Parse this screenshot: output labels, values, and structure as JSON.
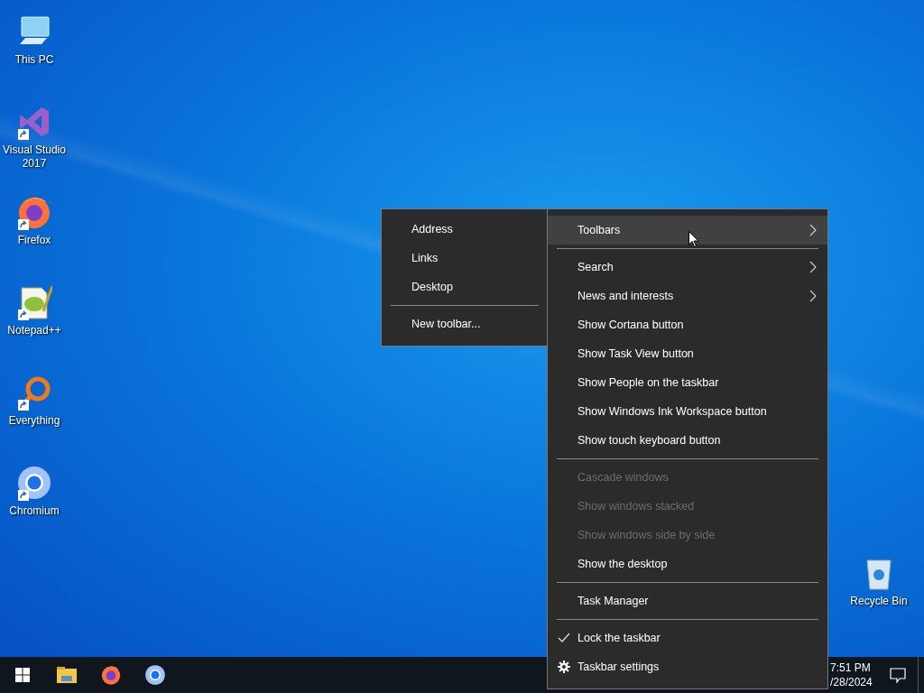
{
  "desktop_icons": [
    {
      "label": "This PC",
      "kind": "pc",
      "shortcut": false
    },
    {
      "label": "Visual Studio 2017",
      "kind": "vs",
      "shortcut": true
    },
    {
      "label": "Firefox",
      "kind": "firefox",
      "shortcut": true
    },
    {
      "label": "Notepad++",
      "kind": "notepad",
      "shortcut": true
    },
    {
      "label": "Everything",
      "kind": "everything",
      "shortcut": true
    },
    {
      "label": "Chromium",
      "kind": "chromium",
      "shortcut": true
    }
  ],
  "recycle_bin": {
    "label": "Recycle Bin"
  },
  "toolbars_submenu": [
    {
      "kind": "item",
      "label": "Address",
      "checked": false
    },
    {
      "kind": "item",
      "label": "Links",
      "checked": false
    },
    {
      "kind": "item",
      "label": "Desktop",
      "checked": false
    },
    {
      "kind": "separator"
    },
    {
      "kind": "item",
      "label": "New toolbar...",
      "checked": false
    }
  ],
  "context_menu": [
    {
      "kind": "item",
      "label": "Toolbars",
      "submenu": true,
      "disabled": false,
      "checked": false,
      "highlighted": true
    },
    {
      "kind": "separator"
    },
    {
      "kind": "item",
      "label": "Search",
      "submenu": true,
      "disabled": false,
      "checked": false,
      "highlighted": false
    },
    {
      "kind": "item",
      "label": "News and interests",
      "submenu": true,
      "disabled": false,
      "checked": false,
      "highlighted": false
    },
    {
      "kind": "item",
      "label": "Show Cortana button",
      "submenu": false,
      "disabled": false,
      "checked": false,
      "highlighted": false
    },
    {
      "kind": "item",
      "label": "Show Task View button",
      "submenu": false,
      "disabled": false,
      "checked": false,
      "highlighted": false
    },
    {
      "kind": "item",
      "label": "Show People on the taskbar",
      "submenu": false,
      "disabled": false,
      "checked": false,
      "highlighted": false
    },
    {
      "kind": "item",
      "label": "Show Windows Ink Workspace button",
      "submenu": false,
      "disabled": false,
      "checked": false,
      "highlighted": false
    },
    {
      "kind": "item",
      "label": "Show touch keyboard button",
      "submenu": false,
      "disabled": false,
      "checked": false,
      "highlighted": false
    },
    {
      "kind": "separator"
    },
    {
      "kind": "item",
      "label": "Cascade windows",
      "submenu": false,
      "disabled": true,
      "checked": false,
      "highlighted": false
    },
    {
      "kind": "item",
      "label": "Show windows stacked",
      "submenu": false,
      "disabled": true,
      "checked": false,
      "highlighted": false
    },
    {
      "kind": "item",
      "label": "Show windows side by side",
      "submenu": false,
      "disabled": true,
      "checked": false,
      "highlighted": false
    },
    {
      "kind": "item",
      "label": "Show the desktop",
      "submenu": false,
      "disabled": false,
      "checked": false,
      "highlighted": false
    },
    {
      "kind": "separator"
    },
    {
      "kind": "item",
      "label": "Task Manager",
      "submenu": false,
      "disabled": false,
      "checked": false,
      "highlighted": false
    },
    {
      "kind": "separator"
    },
    {
      "kind": "item",
      "label": "Lock the taskbar",
      "submenu": false,
      "disabled": false,
      "checked": true,
      "highlighted": false
    },
    {
      "kind": "settings",
      "label": "Taskbar settings",
      "submenu": false,
      "disabled": false,
      "checked": false,
      "highlighted": false
    }
  ],
  "taskbar": {
    "apps": [
      {
        "kind": "start"
      },
      {
        "kind": "explorer"
      },
      {
        "kind": "firefox"
      },
      {
        "kind": "chromium"
      }
    ],
    "clock": {
      "time": "7:51 PM",
      "date": "/28/2024"
    }
  }
}
